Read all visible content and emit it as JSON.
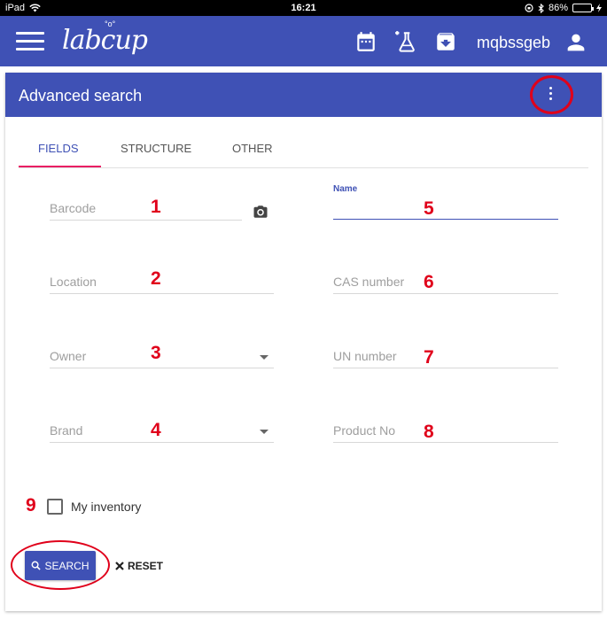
{
  "status_bar": {
    "device": "iPad",
    "time": "16:21",
    "battery_text": "86%",
    "battery_level": 0.86,
    "icons": [
      "wifi-icon",
      "orientation-lock-icon",
      "bluetooth-icon",
      "battery-icon",
      "charging-icon"
    ]
  },
  "app_bar": {
    "logo": "labcup",
    "username": "mqbssgeb",
    "icons": [
      "menu-icon",
      "calendar-icon",
      "flask-plus-icon",
      "download-box-icon",
      "person-icon"
    ]
  },
  "card": {
    "title": "Advanced search",
    "menu_icon": "more-vert-icon"
  },
  "tabs": [
    {
      "label": "FIELDS",
      "active": true
    },
    {
      "label": "STRUCTURE",
      "active": false
    },
    {
      "label": "OTHER",
      "active": false
    }
  ],
  "fields": {
    "barcode": {
      "placeholder": "Barcode",
      "marker": "1"
    },
    "location": {
      "placeholder": "Location",
      "marker": "2"
    },
    "owner": {
      "placeholder": "Owner",
      "marker": "3"
    },
    "brand": {
      "placeholder": "Brand",
      "marker": "4"
    },
    "name": {
      "label": "Name",
      "value": "",
      "marker": "5"
    },
    "cas_number": {
      "placeholder": "CAS number",
      "marker": "6"
    },
    "un_number": {
      "placeholder": "UN number",
      "marker": "7"
    },
    "product_no": {
      "placeholder": "Product No",
      "marker": "8"
    }
  },
  "my_inventory": {
    "label": "My inventory",
    "checked": false,
    "marker": "9"
  },
  "buttons": {
    "search": "SEARCH",
    "reset": "RESET"
  },
  "colors": {
    "primary": "#3f51b5",
    "tab_indicator": "#e91e63",
    "annotation_red": "#e0001a"
  }
}
